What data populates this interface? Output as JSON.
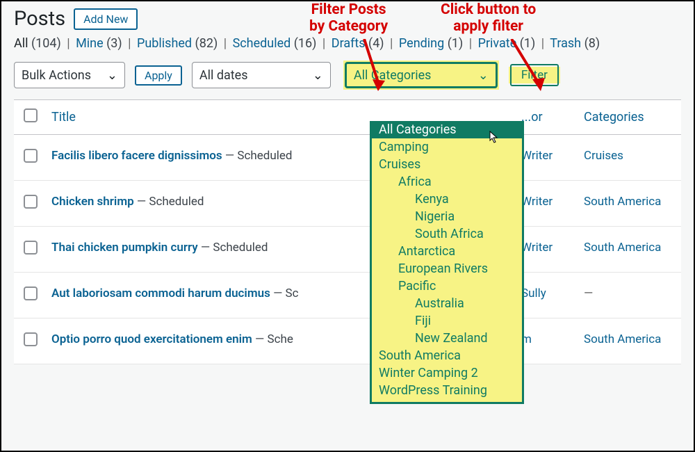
{
  "header": {
    "title": "Posts",
    "addNew": "Add New"
  },
  "annotations": {
    "filterPosts": "Filter Posts\nby Category",
    "clickButton": "Click button to\napply filter"
  },
  "subsub": [
    {
      "label": "All",
      "count": "(104)",
      "current": true
    },
    {
      "label": "Mine",
      "count": "(3)"
    },
    {
      "label": "Published",
      "count": "(82)"
    },
    {
      "label": "Scheduled",
      "count": "(16)"
    },
    {
      "label": "Drafts",
      "count": "(4)"
    },
    {
      "label": "Pending",
      "count": "(1)"
    },
    {
      "label": "Private",
      "count": "(1)"
    },
    {
      "label": "Trash",
      "count": "(8)"
    }
  ],
  "filters": {
    "bulk": "Bulk Actions",
    "apply": "Apply",
    "dates": "All dates",
    "category": "All Categories",
    "filterBtn": "Filter"
  },
  "dropdown": [
    {
      "label": "All Categories",
      "indent": 0,
      "selected": true
    },
    {
      "label": "Camping",
      "indent": 0
    },
    {
      "label": "Cruises",
      "indent": 0
    },
    {
      "label": "Africa",
      "indent": 1
    },
    {
      "label": "Kenya",
      "indent": 2
    },
    {
      "label": "Nigeria",
      "indent": 2
    },
    {
      "label": "South Africa",
      "indent": 2
    },
    {
      "label": "Antarctica",
      "indent": 1
    },
    {
      "label": "European Rivers",
      "indent": 1
    },
    {
      "label": "Pacific",
      "indent": 1
    },
    {
      "label": "Australia",
      "indent": 2
    },
    {
      "label": "Fiji",
      "indent": 2
    },
    {
      "label": "New Zealand",
      "indent": 2
    },
    {
      "label": "South America",
      "indent": 0
    },
    {
      "label": "Winter Camping 2",
      "indent": 0
    },
    {
      "label": "WordPress Training",
      "indent": 0
    }
  ],
  "table": {
    "cols": {
      "title": "Title",
      "author": "...or",
      "categories": "Categories"
    },
    "rows": [
      {
        "title": "Facilis libero facere dignissimos",
        "status": "Scheduled",
        "author": "Writer",
        "categories": "Cruises"
      },
      {
        "title": "Chicken shrimp",
        "status": "Scheduled",
        "author": "Writer",
        "categories": "South America"
      },
      {
        "title": "Thai chicken pumpkin curry",
        "status": "Scheduled",
        "author": "Writer",
        "categories": "South America"
      },
      {
        "title": "Aut laboriosam commodi harum ducimus",
        "status": "Sc",
        "author": "Sully",
        "categories": "—"
      },
      {
        "title": "Optio porro quod exercitationem enim",
        "status": "Sche",
        "author": "m",
        "categories": "South America"
      }
    ]
  }
}
